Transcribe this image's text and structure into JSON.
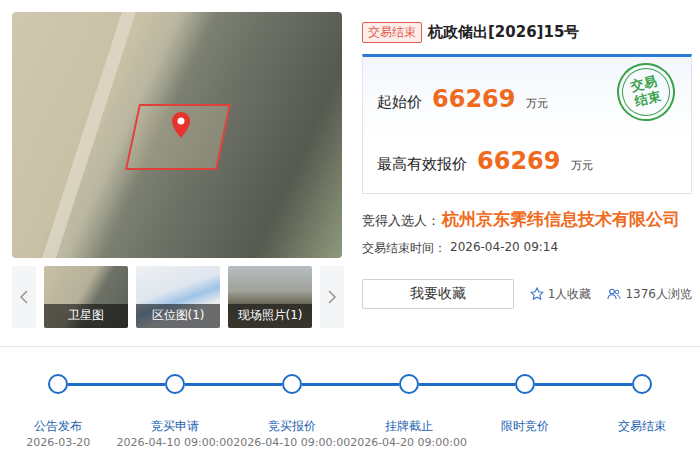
{
  "gallery": {
    "thumbnails": [
      {
        "label": "卫星图"
      },
      {
        "label": "区位图(1)"
      },
      {
        "label": "现场照片(1)"
      }
    ]
  },
  "listing": {
    "status_badge": "交易结束",
    "title": "杭政储出[2026]15号"
  },
  "prices": [
    {
      "label": "起始价",
      "value": "66269",
      "unit": "万元"
    },
    {
      "label": "最高有效报价",
      "value": "66269",
      "unit": "万元"
    }
  ],
  "stamp": "交易结束",
  "winner": {
    "label": "竞得入选人：",
    "name": "杭州京东霁纬信息技术有限公司"
  },
  "end_time": {
    "label": "交易结束时间：",
    "value": "2026-04-20 09:14"
  },
  "favorite_button": "我要收藏",
  "stats": [
    {
      "kind": "favorites",
      "text": "1人收藏"
    },
    {
      "kind": "views",
      "text": "1376人浏览"
    }
  ],
  "timeline": [
    {
      "label": "公告发布",
      "date": "2026-03-20"
    },
    {
      "label": "竞买申请",
      "date": "2026-04-10 09:00:00"
    },
    {
      "label": "竞买报价",
      "date": "2026-04-10 09:00:00"
    },
    {
      "label": "挂牌截止",
      "date": "2026-04-20 09:00:00"
    },
    {
      "label": "限时竞价"
    },
    {
      "label": "交易结束"
    }
  ]
}
